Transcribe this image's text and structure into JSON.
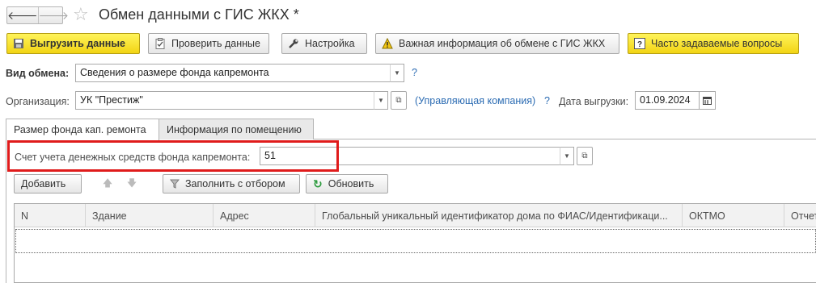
{
  "window": {
    "back_icon": "arrow-left-icon",
    "forward_icon": "arrow-right-icon",
    "favorite_icon": "star-icon",
    "title": "Обмен данными с ГИС ЖКХ *"
  },
  "toolbar": {
    "export_label": "Выгрузить данные",
    "check_label": "Проверить данные",
    "settings_label": "Настройка",
    "important_info_label": "Важная информация об обмене с ГИС ЖКХ",
    "faq_label": "Часто задаваемые вопросы"
  },
  "form": {
    "exchange_type_label": "Вид обмена:",
    "exchange_type_value": "Сведения о размере фонда капремонта",
    "help_mark": "?",
    "organization_label": "Организация:",
    "organization_value": "УК \"Престиж\"",
    "org_role_link": "(Управляющая компания)",
    "export_date_label": "Дата выгрузки:",
    "export_date_value": "01.09.2024"
  },
  "tabs": [
    {
      "label": "Размер фонда кап. ремонта",
      "active": true
    },
    {
      "label": "Информация по помещению",
      "active": false
    }
  ],
  "fund_tab": {
    "account_label": "Счет учета денежных средств фонда капремонта:",
    "account_value": "51"
  },
  "table_toolbar": {
    "add_label": "Добавить",
    "fill_label": "Заполнить с отбором",
    "refresh_label": "Обновить"
  },
  "table": {
    "columns": [
      "N",
      "Здание",
      "Адрес",
      "Глобальный уникальный идентификатор дома по ФИАС/Идентификаци...",
      "ОКТМО",
      "Отчет"
    ],
    "rows": []
  },
  "colors": {
    "accent_yellow": "#f5dc1e",
    "highlight_red": "#e01b1b",
    "link_blue": "#2c6cb3"
  }
}
